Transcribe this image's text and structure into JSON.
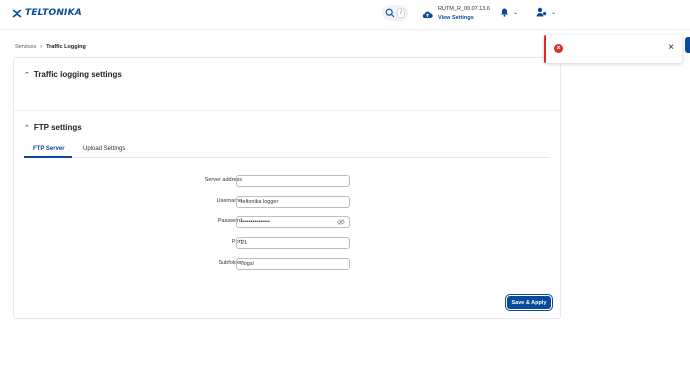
{
  "header": {
    "logo_text": "TELTONIKA",
    "search_shortcut": "/",
    "firmware_version": "RUTM_R_00.07.13.6",
    "view_settings_label": "View Settings"
  },
  "breadcrumb": {
    "parent": "Services",
    "current": "Traffic Logging"
  },
  "sections": {
    "traffic_logging": {
      "title": "Traffic logging settings"
    },
    "ftp": {
      "title": "FTP settings",
      "tabs": [
        {
          "label": "FTP Server",
          "active": true
        },
        {
          "label": "Upload Settings",
          "active": false
        }
      ]
    }
  },
  "form": {
    "server_address": {
      "label": "Server address",
      "value": ""
    },
    "username": {
      "label": "Username",
      "value": "teltonika logger"
    },
    "password": {
      "label": "Password",
      "value": "•••••••••••••••"
    },
    "port": {
      "label": "Port",
      "value": "21"
    },
    "subfolder": {
      "label": "Subfolder",
      "value": "/logs/"
    }
  },
  "actions": {
    "save_label": "Save & Apply"
  },
  "toast": {
    "type": "error",
    "message": ""
  },
  "colors": {
    "brand": "#0a4a9a",
    "error": "#d92d2d"
  }
}
